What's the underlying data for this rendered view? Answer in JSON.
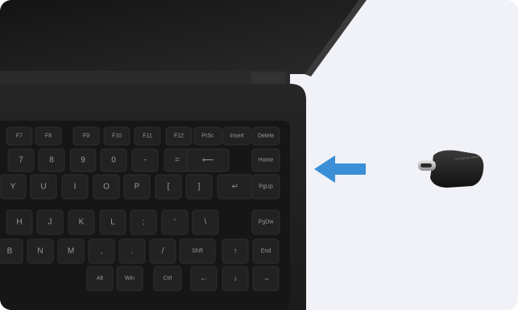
{
  "scene": {
    "background": "#f1f2f8",
    "arrow_color": "#3a8fd6",
    "laptop_color": "#1f1f1f"
  },
  "keyboard": {
    "rows": [
      [
        "F7",
        "F8",
        "F9",
        "F10",
        "F11",
        "F12",
        "PrSc",
        "Insert",
        "Delete"
      ],
      [
        "7",
        "8",
        "9",
        "0",
        "-",
        "=",
        "⟵",
        "Home"
      ],
      [
        "Y",
        "U",
        "I",
        "O",
        "P",
        "[",
        "]",
        "↵",
        "PgUp"
      ],
      [
        "H",
        "J",
        "K",
        "L",
        ";",
        "'",
        "\\",
        "PgDw"
      ],
      [
        "B",
        "N",
        "M",
        ",",
        ".",
        "/",
        "Shift",
        "↑",
        "End"
      ],
      [
        "Alt",
        "Win",
        "Ctrl",
        "←",
        "↓",
        "→"
      ]
    ]
  },
  "adapter": {
    "label": "USB-C",
    "engraving": "TECHNICAL BRAIN"
  },
  "icons": {
    "arrow": "arrow-left-icon"
  }
}
